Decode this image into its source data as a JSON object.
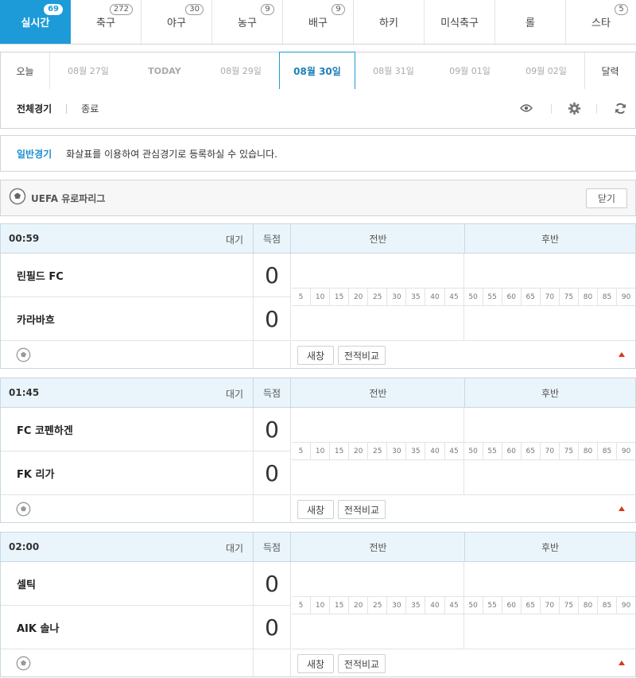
{
  "tabs": [
    {
      "label": "실시간",
      "badge": "69"
    },
    {
      "label": "축구",
      "badge": "272"
    },
    {
      "label": "야구",
      "badge": "30"
    },
    {
      "label": "농구",
      "badge": "9"
    },
    {
      "label": "배구",
      "badge": "9"
    },
    {
      "label": "하키",
      "badge": ""
    },
    {
      "label": "미식축구",
      "badge": ""
    },
    {
      "label": "롤",
      "badge": ""
    },
    {
      "label": "스타",
      "badge": "5"
    }
  ],
  "dates": {
    "today_label": "오늘",
    "items": [
      "08월 27일",
      "TODAY",
      "08월 29일",
      "08월 30일",
      "08월 31일",
      "09월 01일",
      "09월 02일"
    ],
    "selected": "08월 30일",
    "calendar_label": "달력"
  },
  "filter": {
    "all": "전체경기",
    "finished": "종료"
  },
  "notice": {
    "label": "일반경기",
    "message": "화살표를 이용하여 관심경기로 등록하실 수 있습니다."
  },
  "league": {
    "name": "UEFA 유로파리그",
    "close_label": "닫기"
  },
  "header_labels": {
    "score": "득점",
    "first_half": "전반",
    "second_half": "후반",
    "status": "대기"
  },
  "timeline_ticks": [
    "5",
    "10",
    "15",
    "20",
    "25",
    "30",
    "35",
    "40",
    "45",
    "50",
    "55",
    "60",
    "65",
    "70",
    "75",
    "80",
    "85",
    "90"
  ],
  "buttons": {
    "refresh": "새창",
    "compare": "전적비교"
  },
  "matches": [
    {
      "time": "00:59",
      "status": "대기",
      "home": "린필드 FC",
      "away": "카라바흐",
      "home_score": "0",
      "away_score": "0"
    },
    {
      "time": "01:45",
      "status": "대기",
      "home": "FC 코펜하겐",
      "away": "FK 리가",
      "home_score": "0",
      "away_score": "0"
    },
    {
      "time": "02:00",
      "status": "대기",
      "home": "셀틱",
      "away": "AIK 솔나",
      "home_score": "0",
      "away_score": "0"
    }
  ],
  "colors": {
    "accent": "#1d9bd8",
    "header_bg": "#eaf5fb",
    "arrow": "#d43a1a"
  }
}
